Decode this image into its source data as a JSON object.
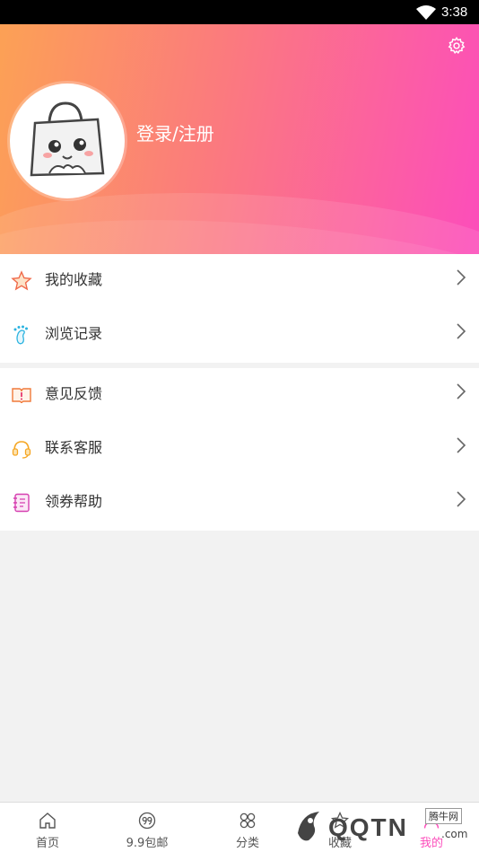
{
  "status_bar": {
    "time": "3:38"
  },
  "header": {
    "login_label": "登录/注册"
  },
  "menu": {
    "group1": [
      {
        "label": "我的收藏",
        "icon": "star-icon"
      },
      {
        "label": "浏览记录",
        "icon": "footprint-icon"
      }
    ],
    "group2": [
      {
        "label": "意见反馈",
        "icon": "feedback-book-icon"
      },
      {
        "label": "联系客服",
        "icon": "headset-icon"
      },
      {
        "label": "领券帮助",
        "icon": "notebook-icon"
      }
    ]
  },
  "bottom_nav": [
    {
      "label": "首页",
      "icon": "home-icon"
    },
    {
      "label": "9.9包邮",
      "icon": "ninety-nine-icon"
    },
    {
      "label": "分类",
      "icon": "category-icon"
    },
    {
      "label": "收藏",
      "icon": "star-outline-icon"
    },
    {
      "label": "我的",
      "icon": "user-icon"
    }
  ],
  "watermark": {
    "text": "QQTN",
    "badge": "腾牛网",
    "suffix": ".com"
  },
  "colors": {
    "gradient_start": "#fca155",
    "gradient_mid": "#fb7a7e",
    "gradient_end": "#fc4dbb"
  }
}
